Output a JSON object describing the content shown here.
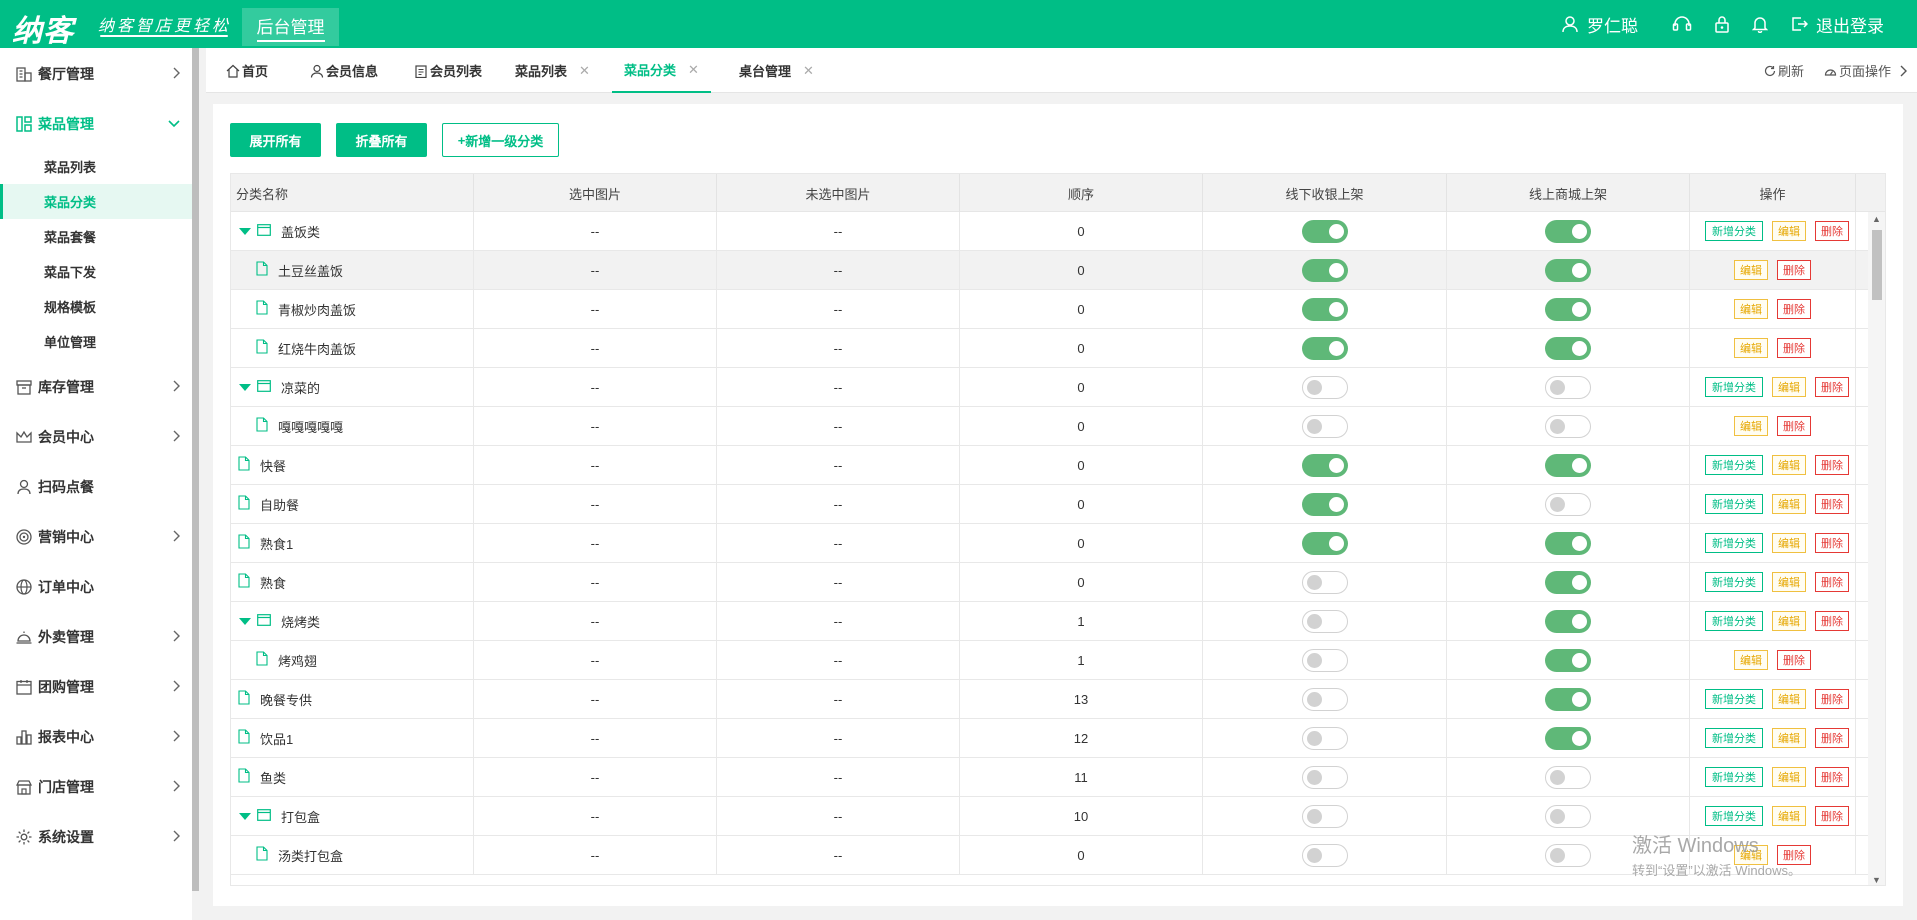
{
  "header": {
    "logo": "纳客",
    "slogan": "纳客智店更轻松",
    "nav_active": "后台管理",
    "user_name": "罗仁聪",
    "logout": "退出登录"
  },
  "sidebar": {
    "items": [
      {
        "label": "餐厅管理"
      },
      {
        "label": "菜品管理"
      },
      {
        "label": "库存管理"
      },
      {
        "label": "会员中心"
      },
      {
        "label": "扫码点餐"
      },
      {
        "label": "营销中心"
      },
      {
        "label": "订单中心"
      },
      {
        "label": "外卖管理"
      },
      {
        "label": "团购管理"
      },
      {
        "label": "报表中心"
      },
      {
        "label": "门店管理"
      },
      {
        "label": "系统设置"
      }
    ],
    "submenu": [
      "菜品列表",
      "菜品分类",
      "菜品套餐",
      "菜品下发",
      "规格模板",
      "单位管理"
    ]
  },
  "tabs": [
    {
      "label": "首页"
    },
    {
      "label": "会员信息"
    },
    {
      "label": "会员列表"
    },
    {
      "label": "菜品列表"
    },
    {
      "label": "菜品分类"
    },
    {
      "label": "桌台管理"
    }
  ],
  "tab_tools": {
    "refresh": "刷新",
    "page_ops": "页面操作"
  },
  "toolbar": {
    "expand_all": "展开所有",
    "collapse_all": "折叠所有",
    "add_top": "新增一级分类"
  },
  "table": {
    "columns": [
      "分类名称",
      "选中图片",
      "未选中图片",
      "顺序",
      "线下收银上架",
      "线上商城上架",
      "操作"
    ],
    "rows": [
      {
        "name": "盖饭类",
        "level": 0,
        "parent": true,
        "img_sel": "--",
        "img_unsel": "--",
        "order": "0",
        "offline": true,
        "online": true
      },
      {
        "name": "土豆丝盖饭",
        "level": 1,
        "parent": false,
        "img_sel": "--",
        "img_unsel": "--",
        "order": "0",
        "offline": true,
        "online": true
      },
      {
        "name": "青椒炒肉盖饭",
        "level": 1,
        "parent": false,
        "img_sel": "--",
        "img_unsel": "--",
        "order": "0",
        "offline": true,
        "online": true
      },
      {
        "name": "红烧牛肉盖饭",
        "level": 1,
        "parent": false,
        "img_sel": "--",
        "img_unsel": "--",
        "order": "0",
        "offline": true,
        "online": true
      },
      {
        "name": "凉菜的",
        "level": 0,
        "parent": true,
        "img_sel": "--",
        "img_unsel": "--",
        "order": "0",
        "offline": false,
        "online": false
      },
      {
        "name": "嘎嘎嘎嘎嘎",
        "level": 1,
        "parent": false,
        "img_sel": "--",
        "img_unsel": "--",
        "order": "0",
        "offline": false,
        "online": false
      },
      {
        "name": "快餐",
        "level": 0,
        "parent": false,
        "img_sel": "--",
        "img_unsel": "--",
        "order": "0",
        "offline": true,
        "online": true
      },
      {
        "name": "自助餐",
        "level": 0,
        "parent": false,
        "img_sel": "--",
        "img_unsel": "--",
        "order": "0",
        "offline": true,
        "online": false
      },
      {
        "name": "熟食1",
        "level": 0,
        "parent": false,
        "img_sel": "--",
        "img_unsel": "--",
        "order": "0",
        "offline": true,
        "online": true
      },
      {
        "name": "熟食",
        "level": 0,
        "parent": false,
        "img_sel": "--",
        "img_unsel": "--",
        "order": "0",
        "offline": false,
        "online": true
      },
      {
        "name": "烧烤类",
        "level": 0,
        "parent": true,
        "img_sel": "--",
        "img_unsel": "--",
        "order": "1",
        "offline": false,
        "online": true
      },
      {
        "name": "烤鸡翅",
        "level": 1,
        "parent": false,
        "img_sel": "--",
        "img_unsel": "--",
        "order": "1",
        "offline": false,
        "online": true
      },
      {
        "name": "晚餐专供",
        "level": 0,
        "parent": false,
        "img_sel": "--",
        "img_unsel": "--",
        "order": "13",
        "offline": false,
        "online": true
      },
      {
        "name": "饮品1",
        "level": 0,
        "parent": false,
        "img_sel": "--",
        "img_unsel": "--",
        "order": "12",
        "offline": false,
        "online": true
      },
      {
        "name": "鱼类",
        "level": 0,
        "parent": false,
        "img_sel": "--",
        "img_unsel": "--",
        "order": "11",
        "offline": false,
        "online": false
      },
      {
        "name": "打包盒",
        "level": 0,
        "parent": true,
        "img_sel": "--",
        "img_unsel": "--",
        "order": "10",
        "offline": false,
        "online": false
      },
      {
        "name": "汤类打包盒",
        "level": 1,
        "parent": false,
        "img_sel": "--",
        "img_unsel": "--",
        "order": "0",
        "offline": false,
        "online": false
      }
    ],
    "actions": {
      "add": "新增分类",
      "edit": "编辑",
      "del": "删除"
    }
  },
  "watermark": {
    "line1": "激活 Windows",
    "line2": "转到“设置”以激活 Windows。"
  },
  "colors": {
    "brand": "#00be86",
    "switch_on": "#5fb878",
    "edit": "#e6a700",
    "delete": "#e53935"
  }
}
